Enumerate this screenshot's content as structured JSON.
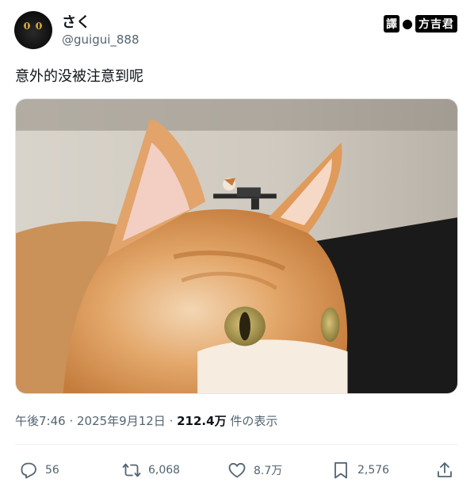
{
  "author": {
    "name": "さく",
    "handle": "@guigui_888",
    "avatar_icon": "black-cat-avatar"
  },
  "watermark": {
    "part1": "譯",
    "separator": "●",
    "part2": "方吉君"
  },
  "tweet": {
    "text": "意外的没被注意到呢"
  },
  "media": {
    "description_icon": "cat-photo-image"
  },
  "meta": {
    "time": "午後7:46",
    "sep1": " · ",
    "date": "2025年9月12日",
    "sep2": " · ",
    "views": "212.4万",
    "views_suffix": " 件の表示"
  },
  "actions": {
    "replies": {
      "icon": "reply-icon",
      "count": "56"
    },
    "retweets": {
      "icon": "retweet-icon",
      "count": "6,068"
    },
    "likes": {
      "icon": "heart-icon",
      "count": "8.7万"
    },
    "bookmarks": {
      "icon": "bookmark-icon",
      "count": "2,576"
    },
    "share": {
      "icon": "share-icon"
    }
  },
  "colors": {
    "text_primary": "#0f1419",
    "text_secondary": "#536471",
    "divider": "#eff3f4"
  }
}
